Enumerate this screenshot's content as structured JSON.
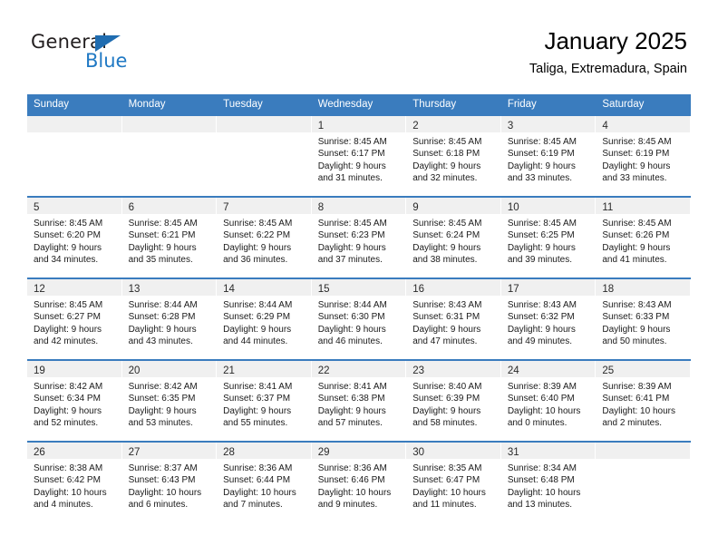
{
  "brand": {
    "name_dark": "General",
    "name_blue": "Blue",
    "accent_color": "#2079c4",
    "header_color": "#3a7cbe"
  },
  "header": {
    "title": "January 2025",
    "subtitle": "Taliga, Extremadura, Spain"
  },
  "weekday_headers": [
    "Sunday",
    "Monday",
    "Tuesday",
    "Wednesday",
    "Thursday",
    "Friday",
    "Saturday"
  ],
  "weeks": [
    [
      {
        "day": "",
        "sunrise": "",
        "sunset": "",
        "daylight1": "",
        "daylight2": ""
      },
      {
        "day": "",
        "sunrise": "",
        "sunset": "",
        "daylight1": "",
        "daylight2": ""
      },
      {
        "day": "",
        "sunrise": "",
        "sunset": "",
        "daylight1": "",
        "daylight2": ""
      },
      {
        "day": "1",
        "sunrise": "Sunrise: 8:45 AM",
        "sunset": "Sunset: 6:17 PM",
        "daylight1": "Daylight: 9 hours",
        "daylight2": "and 31 minutes."
      },
      {
        "day": "2",
        "sunrise": "Sunrise: 8:45 AM",
        "sunset": "Sunset: 6:18 PM",
        "daylight1": "Daylight: 9 hours",
        "daylight2": "and 32 minutes."
      },
      {
        "day": "3",
        "sunrise": "Sunrise: 8:45 AM",
        "sunset": "Sunset: 6:19 PM",
        "daylight1": "Daylight: 9 hours",
        "daylight2": "and 33 minutes."
      },
      {
        "day": "4",
        "sunrise": "Sunrise: 8:45 AM",
        "sunset": "Sunset: 6:19 PM",
        "daylight1": "Daylight: 9 hours",
        "daylight2": "and 33 minutes."
      }
    ],
    [
      {
        "day": "5",
        "sunrise": "Sunrise: 8:45 AM",
        "sunset": "Sunset: 6:20 PM",
        "daylight1": "Daylight: 9 hours",
        "daylight2": "and 34 minutes."
      },
      {
        "day": "6",
        "sunrise": "Sunrise: 8:45 AM",
        "sunset": "Sunset: 6:21 PM",
        "daylight1": "Daylight: 9 hours",
        "daylight2": "and 35 minutes."
      },
      {
        "day": "7",
        "sunrise": "Sunrise: 8:45 AM",
        "sunset": "Sunset: 6:22 PM",
        "daylight1": "Daylight: 9 hours",
        "daylight2": "and 36 minutes."
      },
      {
        "day": "8",
        "sunrise": "Sunrise: 8:45 AM",
        "sunset": "Sunset: 6:23 PM",
        "daylight1": "Daylight: 9 hours",
        "daylight2": "and 37 minutes."
      },
      {
        "day": "9",
        "sunrise": "Sunrise: 8:45 AM",
        "sunset": "Sunset: 6:24 PM",
        "daylight1": "Daylight: 9 hours",
        "daylight2": "and 38 minutes."
      },
      {
        "day": "10",
        "sunrise": "Sunrise: 8:45 AM",
        "sunset": "Sunset: 6:25 PM",
        "daylight1": "Daylight: 9 hours",
        "daylight2": "and 39 minutes."
      },
      {
        "day": "11",
        "sunrise": "Sunrise: 8:45 AM",
        "sunset": "Sunset: 6:26 PM",
        "daylight1": "Daylight: 9 hours",
        "daylight2": "and 41 minutes."
      }
    ],
    [
      {
        "day": "12",
        "sunrise": "Sunrise: 8:45 AM",
        "sunset": "Sunset: 6:27 PM",
        "daylight1": "Daylight: 9 hours",
        "daylight2": "and 42 minutes."
      },
      {
        "day": "13",
        "sunrise": "Sunrise: 8:44 AM",
        "sunset": "Sunset: 6:28 PM",
        "daylight1": "Daylight: 9 hours",
        "daylight2": "and 43 minutes."
      },
      {
        "day": "14",
        "sunrise": "Sunrise: 8:44 AM",
        "sunset": "Sunset: 6:29 PM",
        "daylight1": "Daylight: 9 hours",
        "daylight2": "and 44 minutes."
      },
      {
        "day": "15",
        "sunrise": "Sunrise: 8:44 AM",
        "sunset": "Sunset: 6:30 PM",
        "daylight1": "Daylight: 9 hours",
        "daylight2": "and 46 minutes."
      },
      {
        "day": "16",
        "sunrise": "Sunrise: 8:43 AM",
        "sunset": "Sunset: 6:31 PM",
        "daylight1": "Daylight: 9 hours",
        "daylight2": "and 47 minutes."
      },
      {
        "day": "17",
        "sunrise": "Sunrise: 8:43 AM",
        "sunset": "Sunset: 6:32 PM",
        "daylight1": "Daylight: 9 hours",
        "daylight2": "and 49 minutes."
      },
      {
        "day": "18",
        "sunrise": "Sunrise: 8:43 AM",
        "sunset": "Sunset: 6:33 PM",
        "daylight1": "Daylight: 9 hours",
        "daylight2": "and 50 minutes."
      }
    ],
    [
      {
        "day": "19",
        "sunrise": "Sunrise: 8:42 AM",
        "sunset": "Sunset: 6:34 PM",
        "daylight1": "Daylight: 9 hours",
        "daylight2": "and 52 minutes."
      },
      {
        "day": "20",
        "sunrise": "Sunrise: 8:42 AM",
        "sunset": "Sunset: 6:35 PM",
        "daylight1": "Daylight: 9 hours",
        "daylight2": "and 53 minutes."
      },
      {
        "day": "21",
        "sunrise": "Sunrise: 8:41 AM",
        "sunset": "Sunset: 6:37 PM",
        "daylight1": "Daylight: 9 hours",
        "daylight2": "and 55 minutes."
      },
      {
        "day": "22",
        "sunrise": "Sunrise: 8:41 AM",
        "sunset": "Sunset: 6:38 PM",
        "daylight1": "Daylight: 9 hours",
        "daylight2": "and 57 minutes."
      },
      {
        "day": "23",
        "sunrise": "Sunrise: 8:40 AM",
        "sunset": "Sunset: 6:39 PM",
        "daylight1": "Daylight: 9 hours",
        "daylight2": "and 58 minutes."
      },
      {
        "day": "24",
        "sunrise": "Sunrise: 8:39 AM",
        "sunset": "Sunset: 6:40 PM",
        "daylight1": "Daylight: 10 hours",
        "daylight2": "and 0 minutes."
      },
      {
        "day": "25",
        "sunrise": "Sunrise: 8:39 AM",
        "sunset": "Sunset: 6:41 PM",
        "daylight1": "Daylight: 10 hours",
        "daylight2": "and 2 minutes."
      }
    ],
    [
      {
        "day": "26",
        "sunrise": "Sunrise: 8:38 AM",
        "sunset": "Sunset: 6:42 PM",
        "daylight1": "Daylight: 10 hours",
        "daylight2": "and 4 minutes."
      },
      {
        "day": "27",
        "sunrise": "Sunrise: 8:37 AM",
        "sunset": "Sunset: 6:43 PM",
        "daylight1": "Daylight: 10 hours",
        "daylight2": "and 6 minutes."
      },
      {
        "day": "28",
        "sunrise": "Sunrise: 8:36 AM",
        "sunset": "Sunset: 6:44 PM",
        "daylight1": "Daylight: 10 hours",
        "daylight2": "and 7 minutes."
      },
      {
        "day": "29",
        "sunrise": "Sunrise: 8:36 AM",
        "sunset": "Sunset: 6:46 PM",
        "daylight1": "Daylight: 10 hours",
        "daylight2": "and 9 minutes."
      },
      {
        "day": "30",
        "sunrise": "Sunrise: 8:35 AM",
        "sunset": "Sunset: 6:47 PM",
        "daylight1": "Daylight: 10 hours",
        "daylight2": "and 11 minutes."
      },
      {
        "day": "31",
        "sunrise": "Sunrise: 8:34 AM",
        "sunset": "Sunset: 6:48 PM",
        "daylight1": "Daylight: 10 hours",
        "daylight2": "and 13 minutes."
      },
      {
        "day": "",
        "sunrise": "",
        "sunset": "",
        "daylight1": "",
        "daylight2": ""
      }
    ]
  ]
}
